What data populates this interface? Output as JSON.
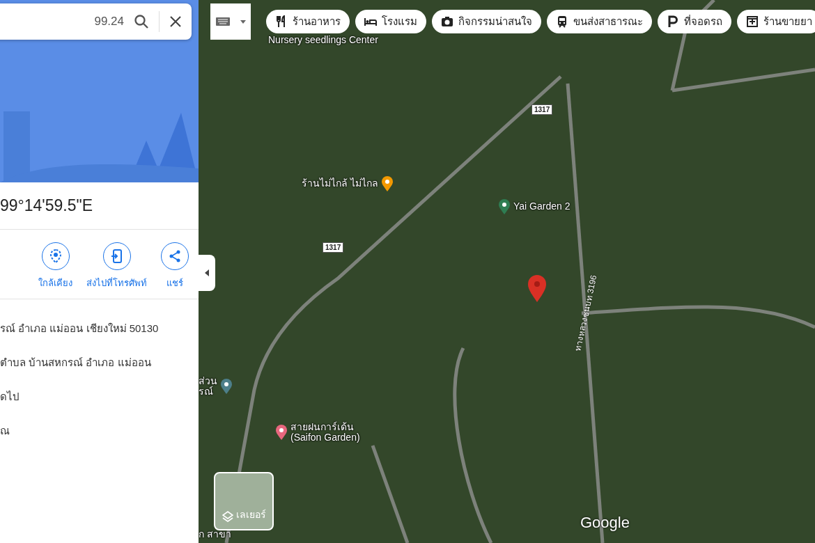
{
  "search": {
    "value": "99.24"
  },
  "place": {
    "title": "99°14'59.5\"E"
  },
  "actions": [
    {
      "label": "ใกล้เคียง",
      "kind": "nearby"
    },
    {
      "label": "ส่งไปที่โทรศัพท์",
      "kind": "phone"
    },
    {
      "label": "แชร์",
      "kind": "share"
    }
  ],
  "info_lines": [
    "รณ์ อำเภอ แม่ออน เชียงใหม่ 50130",
    "ตำบล บ้านสหกรณ์ อำเภอ แม่ออน",
    "ดไป",
    "ณ"
  ],
  "chips": [
    {
      "label": "ร้านอาหาร",
      "kind": "restaurant"
    },
    {
      "label": "โรงแรม",
      "kind": "hotel"
    },
    {
      "label": "กิจกรรมน่าสนใจ",
      "kind": "camera"
    },
    {
      "label": "ขนส่งสาธารณะ",
      "kind": "transit"
    },
    {
      "label": "ที่จอดรถ",
      "kind": "parking"
    },
    {
      "label": "ร้านขายยา",
      "kind": "pharmacy"
    }
  ],
  "map": {
    "labels": [
      {
        "text": "Nursery seedlings Center",
        "kind": "place"
      },
      {
        "text": "ร้านไม่ไกล้ ไม่ไกล",
        "kind": "restaurant"
      },
      {
        "text": "Yai Garden 2",
        "kind": "garden"
      },
      {
        "text": "สายฝนการ์เด้น\n(Saifon Garden)",
        "kind": "hotel"
      },
      {
        "text": "1317",
        "kind": "shield"
      },
      {
        "text": "1317",
        "kind": "shield"
      },
      {
        "text": "ทางหลวงชนบท 3196",
        "kind": "road"
      },
      {
        "text": "ส่วน\nรณ์",
        "kind": "museum"
      },
      {
        "text": "ก สาขา",
        "kind": "place"
      }
    ],
    "layers_button": "เลเยอร์",
    "logo": "Google"
  }
}
